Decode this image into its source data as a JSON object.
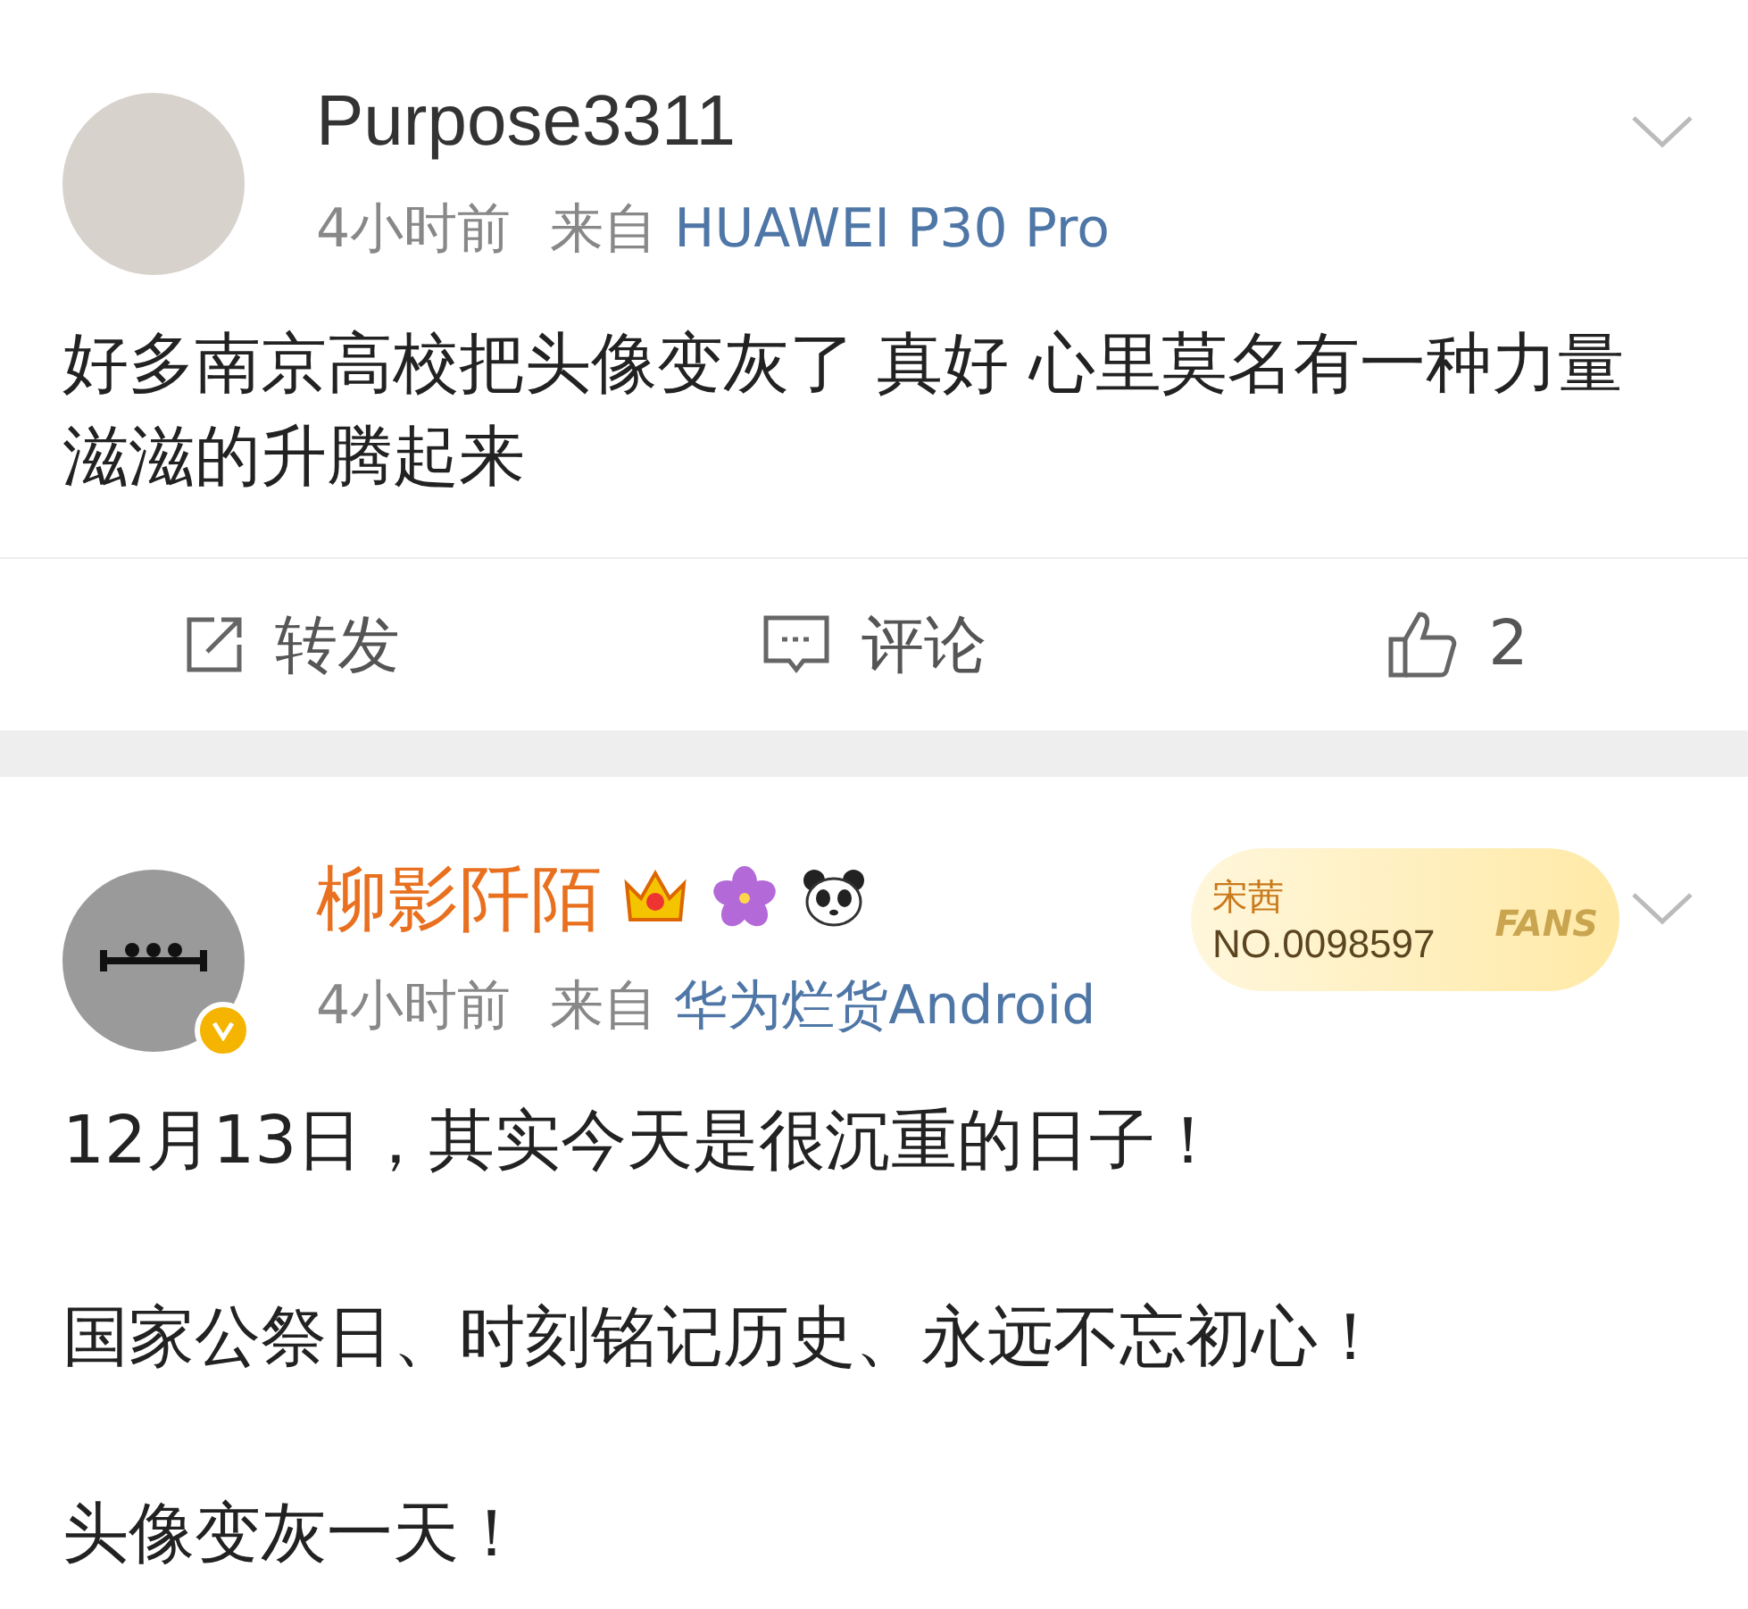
{
  "posts": [
    {
      "author": "Purpose3311",
      "vip": false,
      "photo_avatar": true,
      "time": "4小时前",
      "source_prefix": "来自",
      "source": "HUAWEI P30 Pro",
      "paragraphs": [
        "好多南京高校把头像变灰了 真好 心里莫名有一种力量滋滋的升腾起来"
      ],
      "actions": [
        {
          "kind": "repost",
          "label": "转发"
        },
        {
          "kind": "comment",
          "label": "评论"
        },
        {
          "kind": "like",
          "label": "2"
        }
      ]
    },
    {
      "author": "柳影阡陌",
      "vip": true,
      "verified": true,
      "photo_avatar": false,
      "badges": [
        {
          "kind": "crown"
        },
        {
          "kind": "flower"
        },
        {
          "kind": "panda"
        }
      ],
      "fan_card": {
        "name": "宋茜",
        "number": "NO.0098597",
        "tag": "FANS"
      },
      "time": "4小时前",
      "source_prefix": "来自",
      "source": "华为烂货Android",
      "paragraphs": [
        "12月13日，其实今天是很沉重的日子！",
        "国家公祭日、时刻铭记历史、永远不忘初心！",
        "头像变灰一天！"
      ]
    }
  ]
}
